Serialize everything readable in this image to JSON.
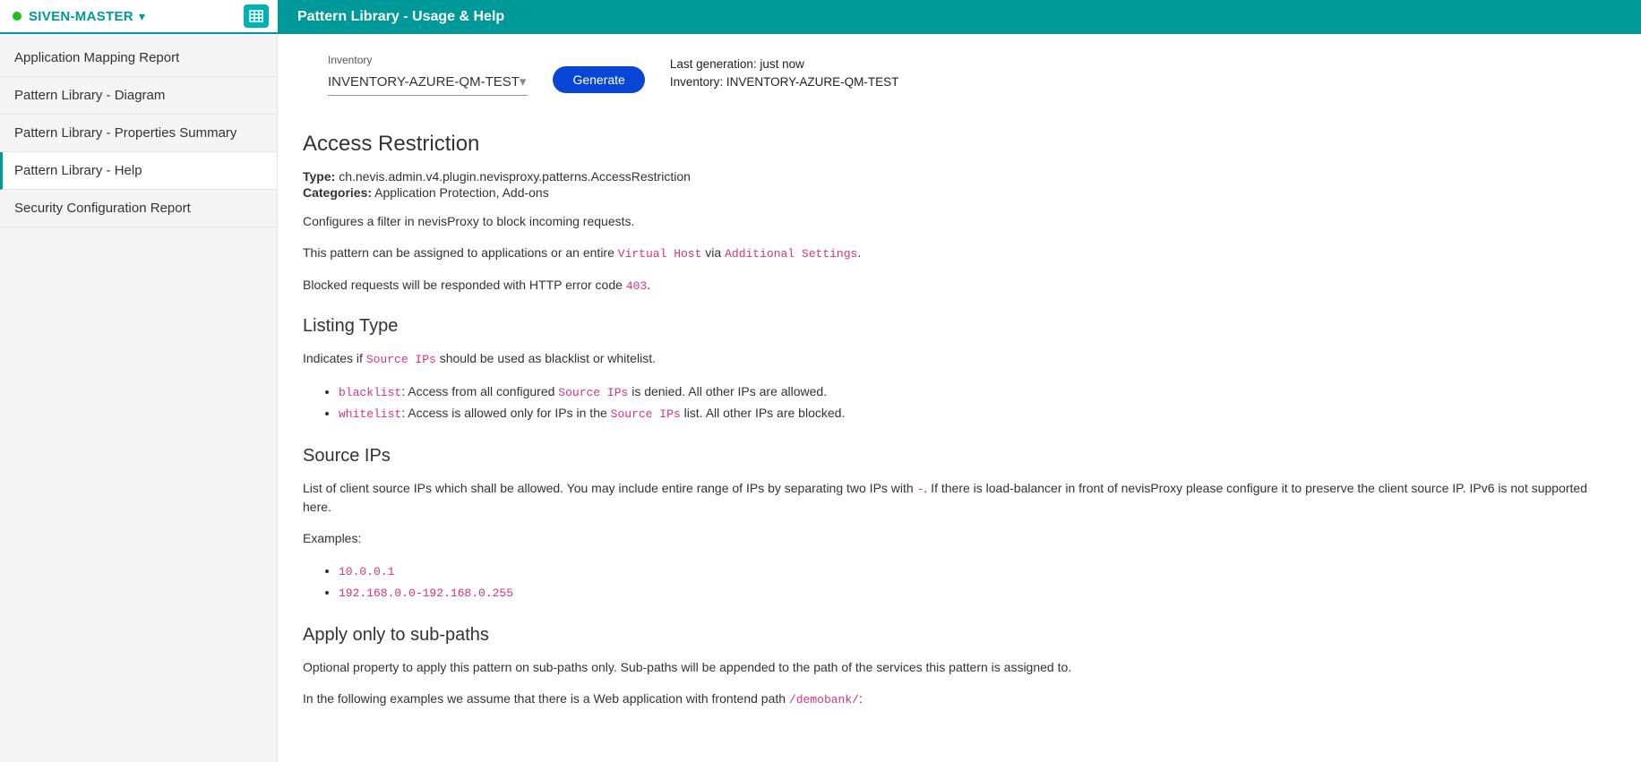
{
  "project": {
    "name": "SIVEN-MASTER"
  },
  "titlebar": "Pattern Library - Usage & Help",
  "sidebar": {
    "items": [
      {
        "label": "Application Mapping Report"
      },
      {
        "label": "Pattern Library - Diagram"
      },
      {
        "label": "Pattern Library - Properties Summary"
      },
      {
        "label": "Pattern Library - Help"
      },
      {
        "label": "Security Configuration Report"
      }
    ]
  },
  "controls": {
    "inventory_label": "Inventory",
    "inventory_value": "INVENTORY-AZURE-QM-TEST",
    "generate_btn": "Generate",
    "status_line1": "Last generation: just now",
    "status_line2": "Inventory: INVENTORY-AZURE-QM-TEST"
  },
  "doc": {
    "h1": "Access Restriction",
    "type_label": "Type:",
    "type_value": "ch.nevis.admin.v4.plugin.nevisproxy.patterns.AccessRestriction",
    "cat_label": "Categories:",
    "cat_value": "Application Protection, Add-ons",
    "p1": "Configures a filter in nevisProxy to block incoming requests.",
    "p2a": "This pattern can be assigned to applications or an entire ",
    "p2_code1": "Virtual Host",
    "p2b": " via ",
    "p2_code2": "Additional Settings",
    "p2c": ".",
    "p3a": "Blocked requests will be responded with HTTP error code ",
    "p3_code": "403",
    "p3b": ".",
    "h2_listing": "Listing Type",
    "listing_pa": "Indicates if ",
    "listing_code": "Source IPs",
    "listing_pb": " should be used as blacklist or whitelist.",
    "li_bl_code": "blacklist",
    "li_bl_a": ": Access from all configured ",
    "li_bl_code2": "Source IPs",
    "li_bl_b": " is denied. All other IPs are allowed.",
    "li_wl_code": "whitelist",
    "li_wl_a": ": Access is allowed only for IPs in the ",
    "li_wl_code2": "Source IPs",
    "li_wl_b": " list. All other IPs are blocked.",
    "h2_src": "Source IPs",
    "src_pa": "List of client source IPs which shall be allowed. You may include entire range of IPs by separating two IPs with ",
    "src_code": "-",
    "src_pb": ". If there is load-balancer in front of nevisProxy please configure it to preserve the client source IP. IPv6 is not supported here.",
    "examples_label": "Examples:",
    "ex1": "10.0.0.1",
    "ex2": "192.168.0.0-192.168.0.255",
    "h2_apply": "Apply only to sub-paths",
    "apply_p1": "Optional property to apply this pattern on sub-paths only. Sub-paths will be appended to the path of the services this pattern is assigned to.",
    "apply_p2a": "In the following examples we assume that there is a Web application with frontend path ",
    "apply_code": "/demobank/",
    "apply_p2b": ":"
  }
}
